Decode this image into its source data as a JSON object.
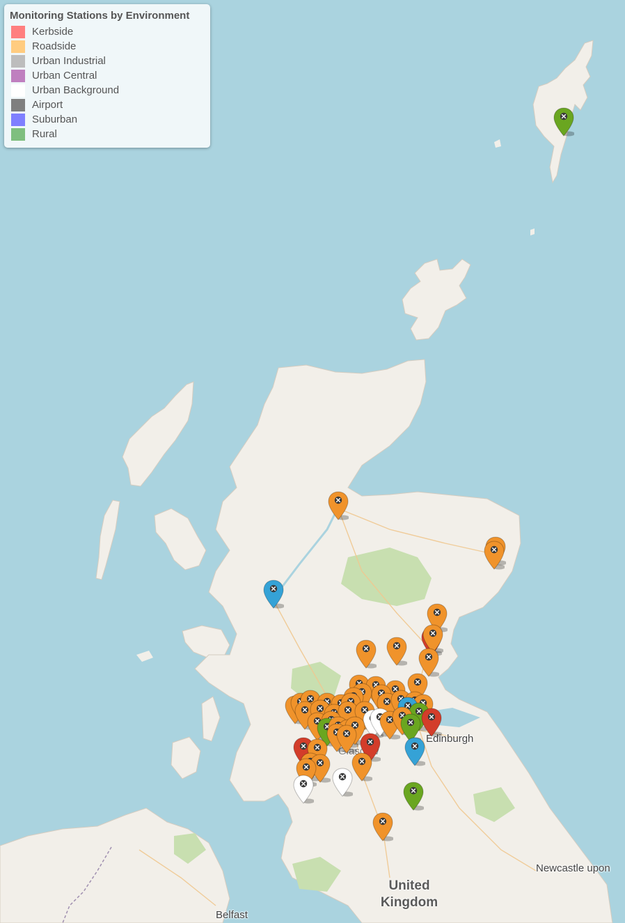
{
  "legend": {
    "title": "Monitoring Stations by Environment",
    "items": [
      {
        "label": "Kerbside",
        "color": "#ff7f7f"
      },
      {
        "label": "Roadside",
        "color": "#ffcc80"
      },
      {
        "label": "Urban Industrial",
        "color": "#bdbdbd"
      },
      {
        "label": "Urban Central",
        "color": "#bf7fbf"
      },
      {
        "label": "Urban Background",
        "color": "#ffffff"
      },
      {
        "label": "Airport",
        "color": "#7f7f7f"
      },
      {
        "label": "Suburban",
        "color": "#7f7fff"
      },
      {
        "label": "Rural",
        "color": "#7fbf7f"
      }
    ]
  },
  "places": {
    "edinburgh": "Edinburgh",
    "glasgow": "Glasgow",
    "newcastle": "Newcastle upon",
    "belfast": "Belfast",
    "country_line1": "United",
    "country_line2": "Kingdom"
  },
  "colors": {
    "sea": "#aad3df",
    "land": "#f2efe9",
    "forest": "#c8dfb0",
    "marker_orange": "#f0932b",
    "marker_green": "#6aa620",
    "marker_blue": "#35a2d6",
    "marker_red": "#d33d2a",
    "marker_white": "#ffffff"
  },
  "marker_icon": "x-icon"
}
